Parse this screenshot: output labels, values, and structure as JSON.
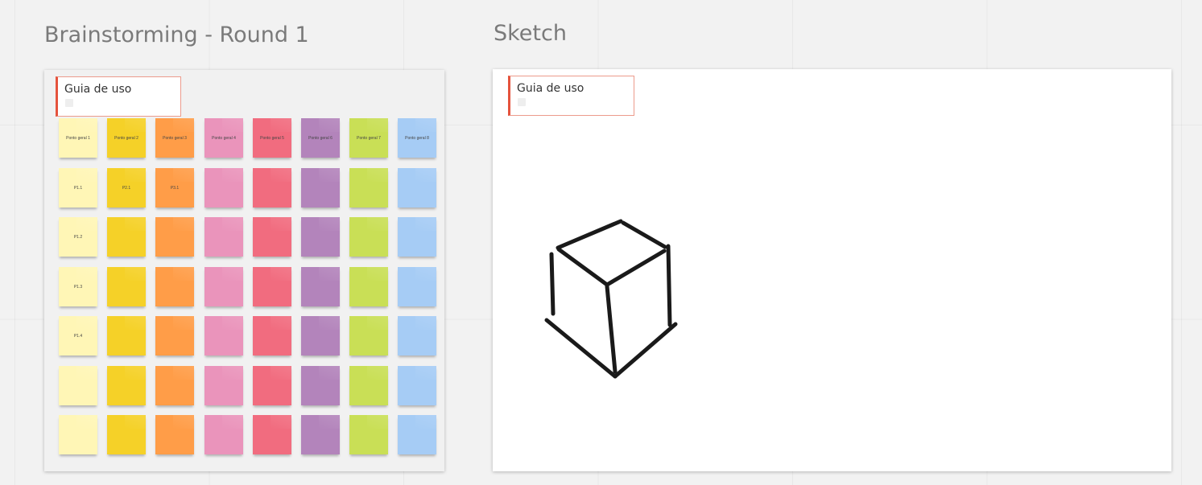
{
  "board": {
    "frames": [
      {
        "title": "Brainstorming - Round 1",
        "guide_label": "Guia de uso"
      },
      {
        "title": "Sketch",
        "guide_label": "Guia de uso"
      }
    ]
  },
  "colors": {
    "columns": [
      "#fff6b6",
      "#f5d128",
      "#ff9d48",
      "#ea94bb",
      "#f16c7f",
      "#b384bb",
      "#c9df56",
      "#a6ccf5"
    ],
    "frame_brainstorm_bg": "#f1f1f1",
    "frame_sketch_bg": "#ffffff",
    "guide_accent": "#e5533d",
    "sketch_stroke": "#1a1a1a"
  },
  "sticky_notes": {
    "columns": 8,
    "rows": 7,
    "labels": [
      [
        "Ponto geral 1",
        "Ponto geral 2",
        "Ponto geral 3",
        "Ponto geral 4",
        "Ponto geral 5",
        "Ponto geral 6",
        "Ponto geral 7",
        "Ponto geral 8"
      ],
      [
        "P1.1",
        "P2.1",
        "P3.1",
        "",
        "",
        "",
        "",
        ""
      ],
      [
        "P1.2",
        "",
        "",
        "",
        "",
        "",
        "",
        ""
      ],
      [
        "P1.3",
        "",
        "",
        "",
        "",
        "",
        "",
        ""
      ],
      [
        "P1.4",
        "",
        "",
        "",
        "",
        "",
        "",
        ""
      ],
      [
        "",
        "",
        "",
        "",
        "",
        "",
        "",
        ""
      ],
      [
        "",
        "",
        "",
        "",
        "",
        "",
        "",
        ""
      ]
    ]
  },
  "sketch": {
    "shape": "cube-drawing"
  }
}
